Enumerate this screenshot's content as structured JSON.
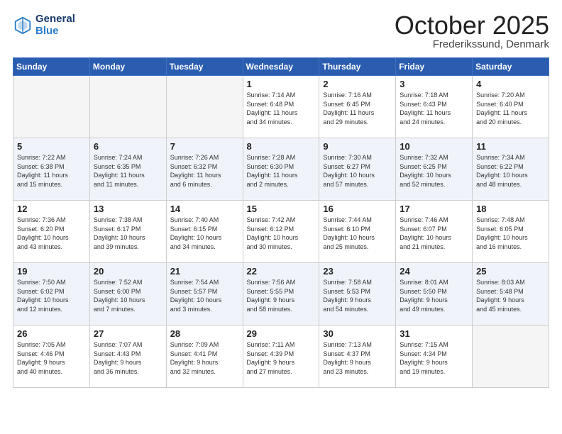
{
  "logo": {
    "line1": "General",
    "line2": "Blue"
  },
  "title": "October 2025",
  "location": "Frederikssund, Denmark",
  "headers": [
    "Sunday",
    "Monday",
    "Tuesday",
    "Wednesday",
    "Thursday",
    "Friday",
    "Saturday"
  ],
  "weeks": [
    [
      {
        "day": "",
        "info": ""
      },
      {
        "day": "",
        "info": ""
      },
      {
        "day": "",
        "info": ""
      },
      {
        "day": "1",
        "info": "Sunrise: 7:14 AM\nSunset: 6:48 PM\nDaylight: 11 hours\nand 34 minutes."
      },
      {
        "day": "2",
        "info": "Sunrise: 7:16 AM\nSunset: 6:45 PM\nDaylight: 11 hours\nand 29 minutes."
      },
      {
        "day": "3",
        "info": "Sunrise: 7:18 AM\nSunset: 6:43 PM\nDaylight: 11 hours\nand 24 minutes."
      },
      {
        "day": "4",
        "info": "Sunrise: 7:20 AM\nSunset: 6:40 PM\nDaylight: 11 hours\nand 20 minutes."
      }
    ],
    [
      {
        "day": "5",
        "info": "Sunrise: 7:22 AM\nSunset: 6:38 PM\nDaylight: 11 hours\nand 15 minutes."
      },
      {
        "day": "6",
        "info": "Sunrise: 7:24 AM\nSunset: 6:35 PM\nDaylight: 11 hours\nand 11 minutes."
      },
      {
        "day": "7",
        "info": "Sunrise: 7:26 AM\nSunset: 6:32 PM\nDaylight: 11 hours\nand 6 minutes."
      },
      {
        "day": "8",
        "info": "Sunrise: 7:28 AM\nSunset: 6:30 PM\nDaylight: 11 hours\nand 2 minutes."
      },
      {
        "day": "9",
        "info": "Sunrise: 7:30 AM\nSunset: 6:27 PM\nDaylight: 10 hours\nand 57 minutes."
      },
      {
        "day": "10",
        "info": "Sunrise: 7:32 AM\nSunset: 6:25 PM\nDaylight: 10 hours\nand 52 minutes."
      },
      {
        "day": "11",
        "info": "Sunrise: 7:34 AM\nSunset: 6:22 PM\nDaylight: 10 hours\nand 48 minutes."
      }
    ],
    [
      {
        "day": "12",
        "info": "Sunrise: 7:36 AM\nSunset: 6:20 PM\nDaylight: 10 hours\nand 43 minutes."
      },
      {
        "day": "13",
        "info": "Sunrise: 7:38 AM\nSunset: 6:17 PM\nDaylight: 10 hours\nand 39 minutes."
      },
      {
        "day": "14",
        "info": "Sunrise: 7:40 AM\nSunset: 6:15 PM\nDaylight: 10 hours\nand 34 minutes."
      },
      {
        "day": "15",
        "info": "Sunrise: 7:42 AM\nSunset: 6:12 PM\nDaylight: 10 hours\nand 30 minutes."
      },
      {
        "day": "16",
        "info": "Sunrise: 7:44 AM\nSunset: 6:10 PM\nDaylight: 10 hours\nand 25 minutes."
      },
      {
        "day": "17",
        "info": "Sunrise: 7:46 AM\nSunset: 6:07 PM\nDaylight: 10 hours\nand 21 minutes."
      },
      {
        "day": "18",
        "info": "Sunrise: 7:48 AM\nSunset: 6:05 PM\nDaylight: 10 hours\nand 16 minutes."
      }
    ],
    [
      {
        "day": "19",
        "info": "Sunrise: 7:50 AM\nSunset: 6:02 PM\nDaylight: 10 hours\nand 12 minutes."
      },
      {
        "day": "20",
        "info": "Sunrise: 7:52 AM\nSunset: 6:00 PM\nDaylight: 10 hours\nand 7 minutes."
      },
      {
        "day": "21",
        "info": "Sunrise: 7:54 AM\nSunset: 5:57 PM\nDaylight: 10 hours\nand 3 minutes."
      },
      {
        "day": "22",
        "info": "Sunrise: 7:56 AM\nSunset: 5:55 PM\nDaylight: 9 hours\nand 58 minutes."
      },
      {
        "day": "23",
        "info": "Sunrise: 7:58 AM\nSunset: 5:53 PM\nDaylight: 9 hours\nand 54 minutes."
      },
      {
        "day": "24",
        "info": "Sunrise: 8:01 AM\nSunset: 5:50 PM\nDaylight: 9 hours\nand 49 minutes."
      },
      {
        "day": "25",
        "info": "Sunrise: 8:03 AM\nSunset: 5:48 PM\nDaylight: 9 hours\nand 45 minutes."
      }
    ],
    [
      {
        "day": "26",
        "info": "Sunrise: 7:05 AM\nSunset: 4:46 PM\nDaylight: 9 hours\nand 40 minutes."
      },
      {
        "day": "27",
        "info": "Sunrise: 7:07 AM\nSunset: 4:43 PM\nDaylight: 9 hours\nand 36 minutes."
      },
      {
        "day": "28",
        "info": "Sunrise: 7:09 AM\nSunset: 4:41 PM\nDaylight: 9 hours\nand 32 minutes."
      },
      {
        "day": "29",
        "info": "Sunrise: 7:11 AM\nSunset: 4:39 PM\nDaylight: 9 hours\nand 27 minutes."
      },
      {
        "day": "30",
        "info": "Sunrise: 7:13 AM\nSunset: 4:37 PM\nDaylight: 9 hours\nand 23 minutes."
      },
      {
        "day": "31",
        "info": "Sunrise: 7:15 AM\nSunset: 4:34 PM\nDaylight: 9 hours\nand 19 minutes."
      },
      {
        "day": "",
        "info": ""
      }
    ]
  ]
}
